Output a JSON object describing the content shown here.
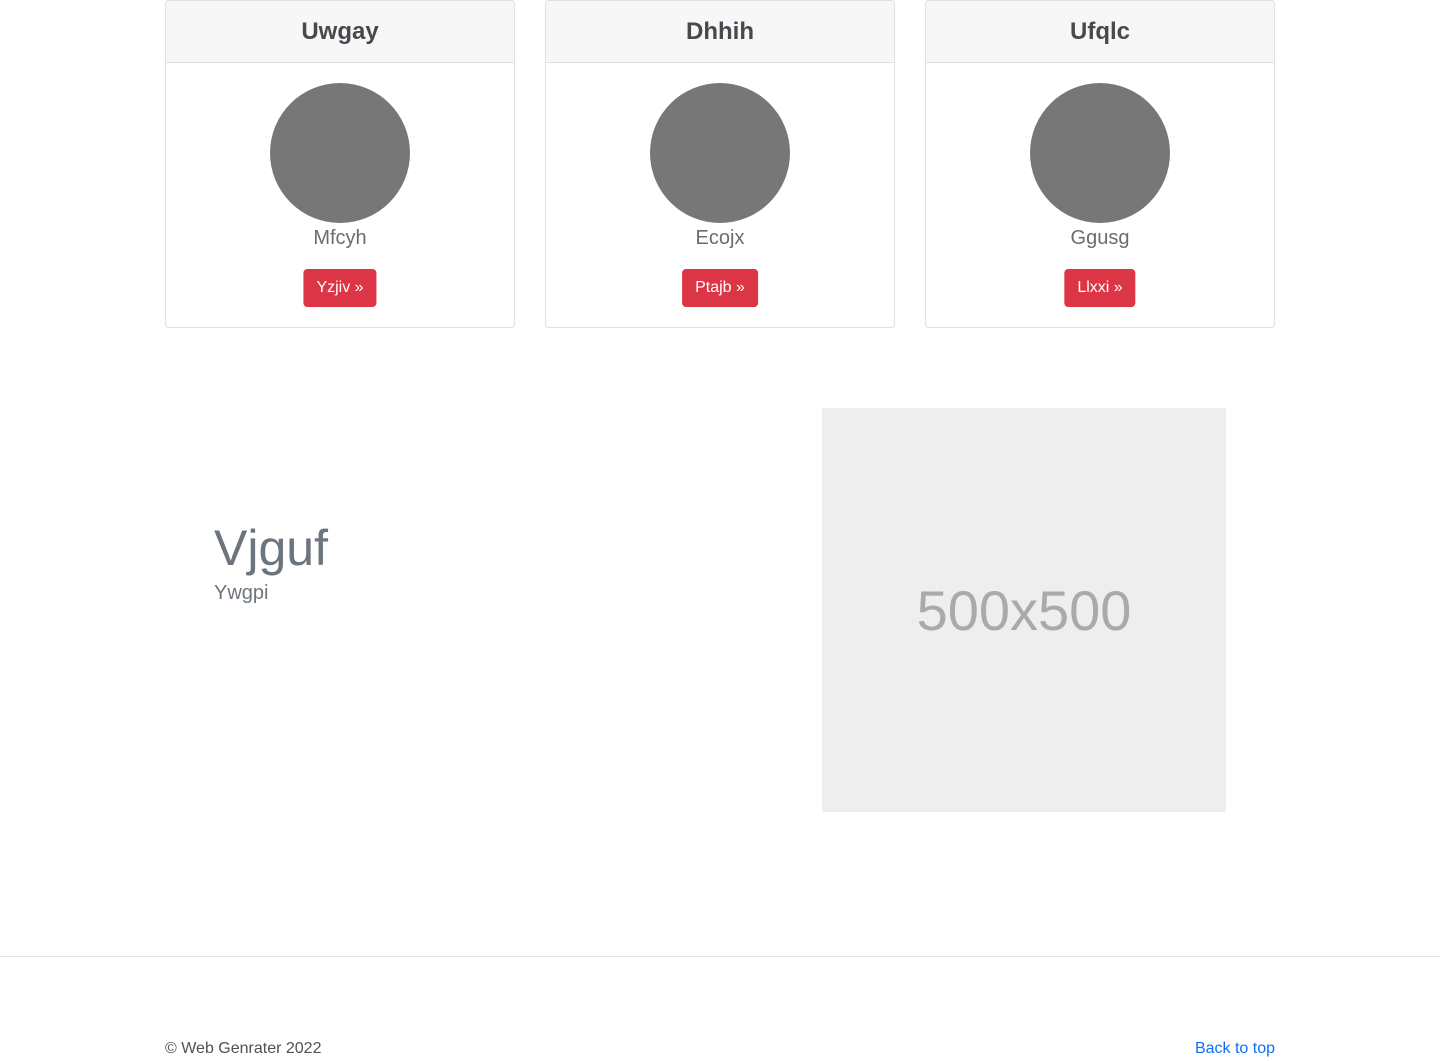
{
  "cards": [
    {
      "title": "Uwgay",
      "subtitle": "Mfcyh",
      "button": "Yzjiv »"
    },
    {
      "title": "Dhhih",
      "subtitle": "Ecojx",
      "button": "Ptajb »"
    },
    {
      "title": "Ufqlc",
      "subtitle": "Ggusg",
      "button": "Llxxi »"
    }
  ],
  "feature": {
    "title": "Vjguf",
    "subtitle": "Ywgpi",
    "image_label": "500x500"
  },
  "footer": {
    "copyright": "© Web Genrater 2022",
    "back_to_top": "Back to top"
  },
  "colors": {
    "button_bg": "#dc3545",
    "avatar": "#777777",
    "link": "#0d6efd",
    "placeholder_bg": "#eeeeee"
  }
}
